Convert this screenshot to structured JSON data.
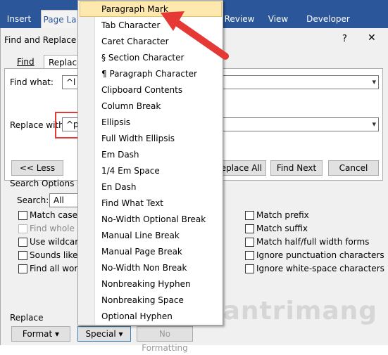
{
  "ribbon": {
    "tabs": [
      "Insert",
      "Page La",
      "Review",
      "View",
      "Developer"
    ]
  },
  "dialog": {
    "title": "Find and Replace",
    "help": "?",
    "close": "✕",
    "tabs": [
      "Find",
      "Replace"
    ],
    "find_what_label": "Find what:",
    "find_what_value": "^l",
    "replace_with_label": "Replace with",
    "replace_with_value": "^p",
    "buttons": {
      "less": "<< Less",
      "replace_all": "Replace All",
      "find_next": "Find Next",
      "cancel": "Cancel"
    },
    "search_options_label": "Search Options",
    "search_label": "Search:",
    "search_value": "All",
    "left_options": [
      {
        "label": "Match case",
        "disabled": false
      },
      {
        "label": "Find whole wo",
        "disabled": true
      },
      {
        "label": "Use wildcards",
        "disabled": false
      },
      {
        "label": "Sounds like (E",
        "disabled": false
      },
      {
        "label": "Find all word f",
        "disabled": false
      }
    ],
    "right_options": [
      {
        "label": "Match prefix"
      },
      {
        "label": "Match suffix"
      },
      {
        "label": "Match half/full width forms"
      },
      {
        "label": "Ignore punctuation characters"
      },
      {
        "label": "Ignore white-space characters"
      }
    ],
    "replace_section_label": "Replace",
    "bottom_buttons": {
      "format": "Format",
      "special": "Special",
      "no_formatting": "No Formatting"
    }
  },
  "special_menu": {
    "items": [
      "Paragraph Mark",
      "Tab Character",
      "Caret Character",
      "§ Section Character",
      "¶ Paragraph Character",
      "Clipboard Contents",
      "Column Break",
      "Ellipsis",
      "Full Width Ellipsis",
      "Em Dash",
      "1/4 Em Space",
      "En Dash",
      "Find What Text",
      "No-Width Optional Break",
      "Manual Line Break",
      "Manual Page Break",
      "No-Width Non Break",
      "Nonbreaking Hyphen",
      "Nonbreaking Space",
      "Optional Hyphen"
    ],
    "highlighted_index": 0
  },
  "watermark": "uantrimang",
  "colors": {
    "ribbon": "#2b579a",
    "highlight": "#fde8b0",
    "annotation_red": "#e53935"
  }
}
